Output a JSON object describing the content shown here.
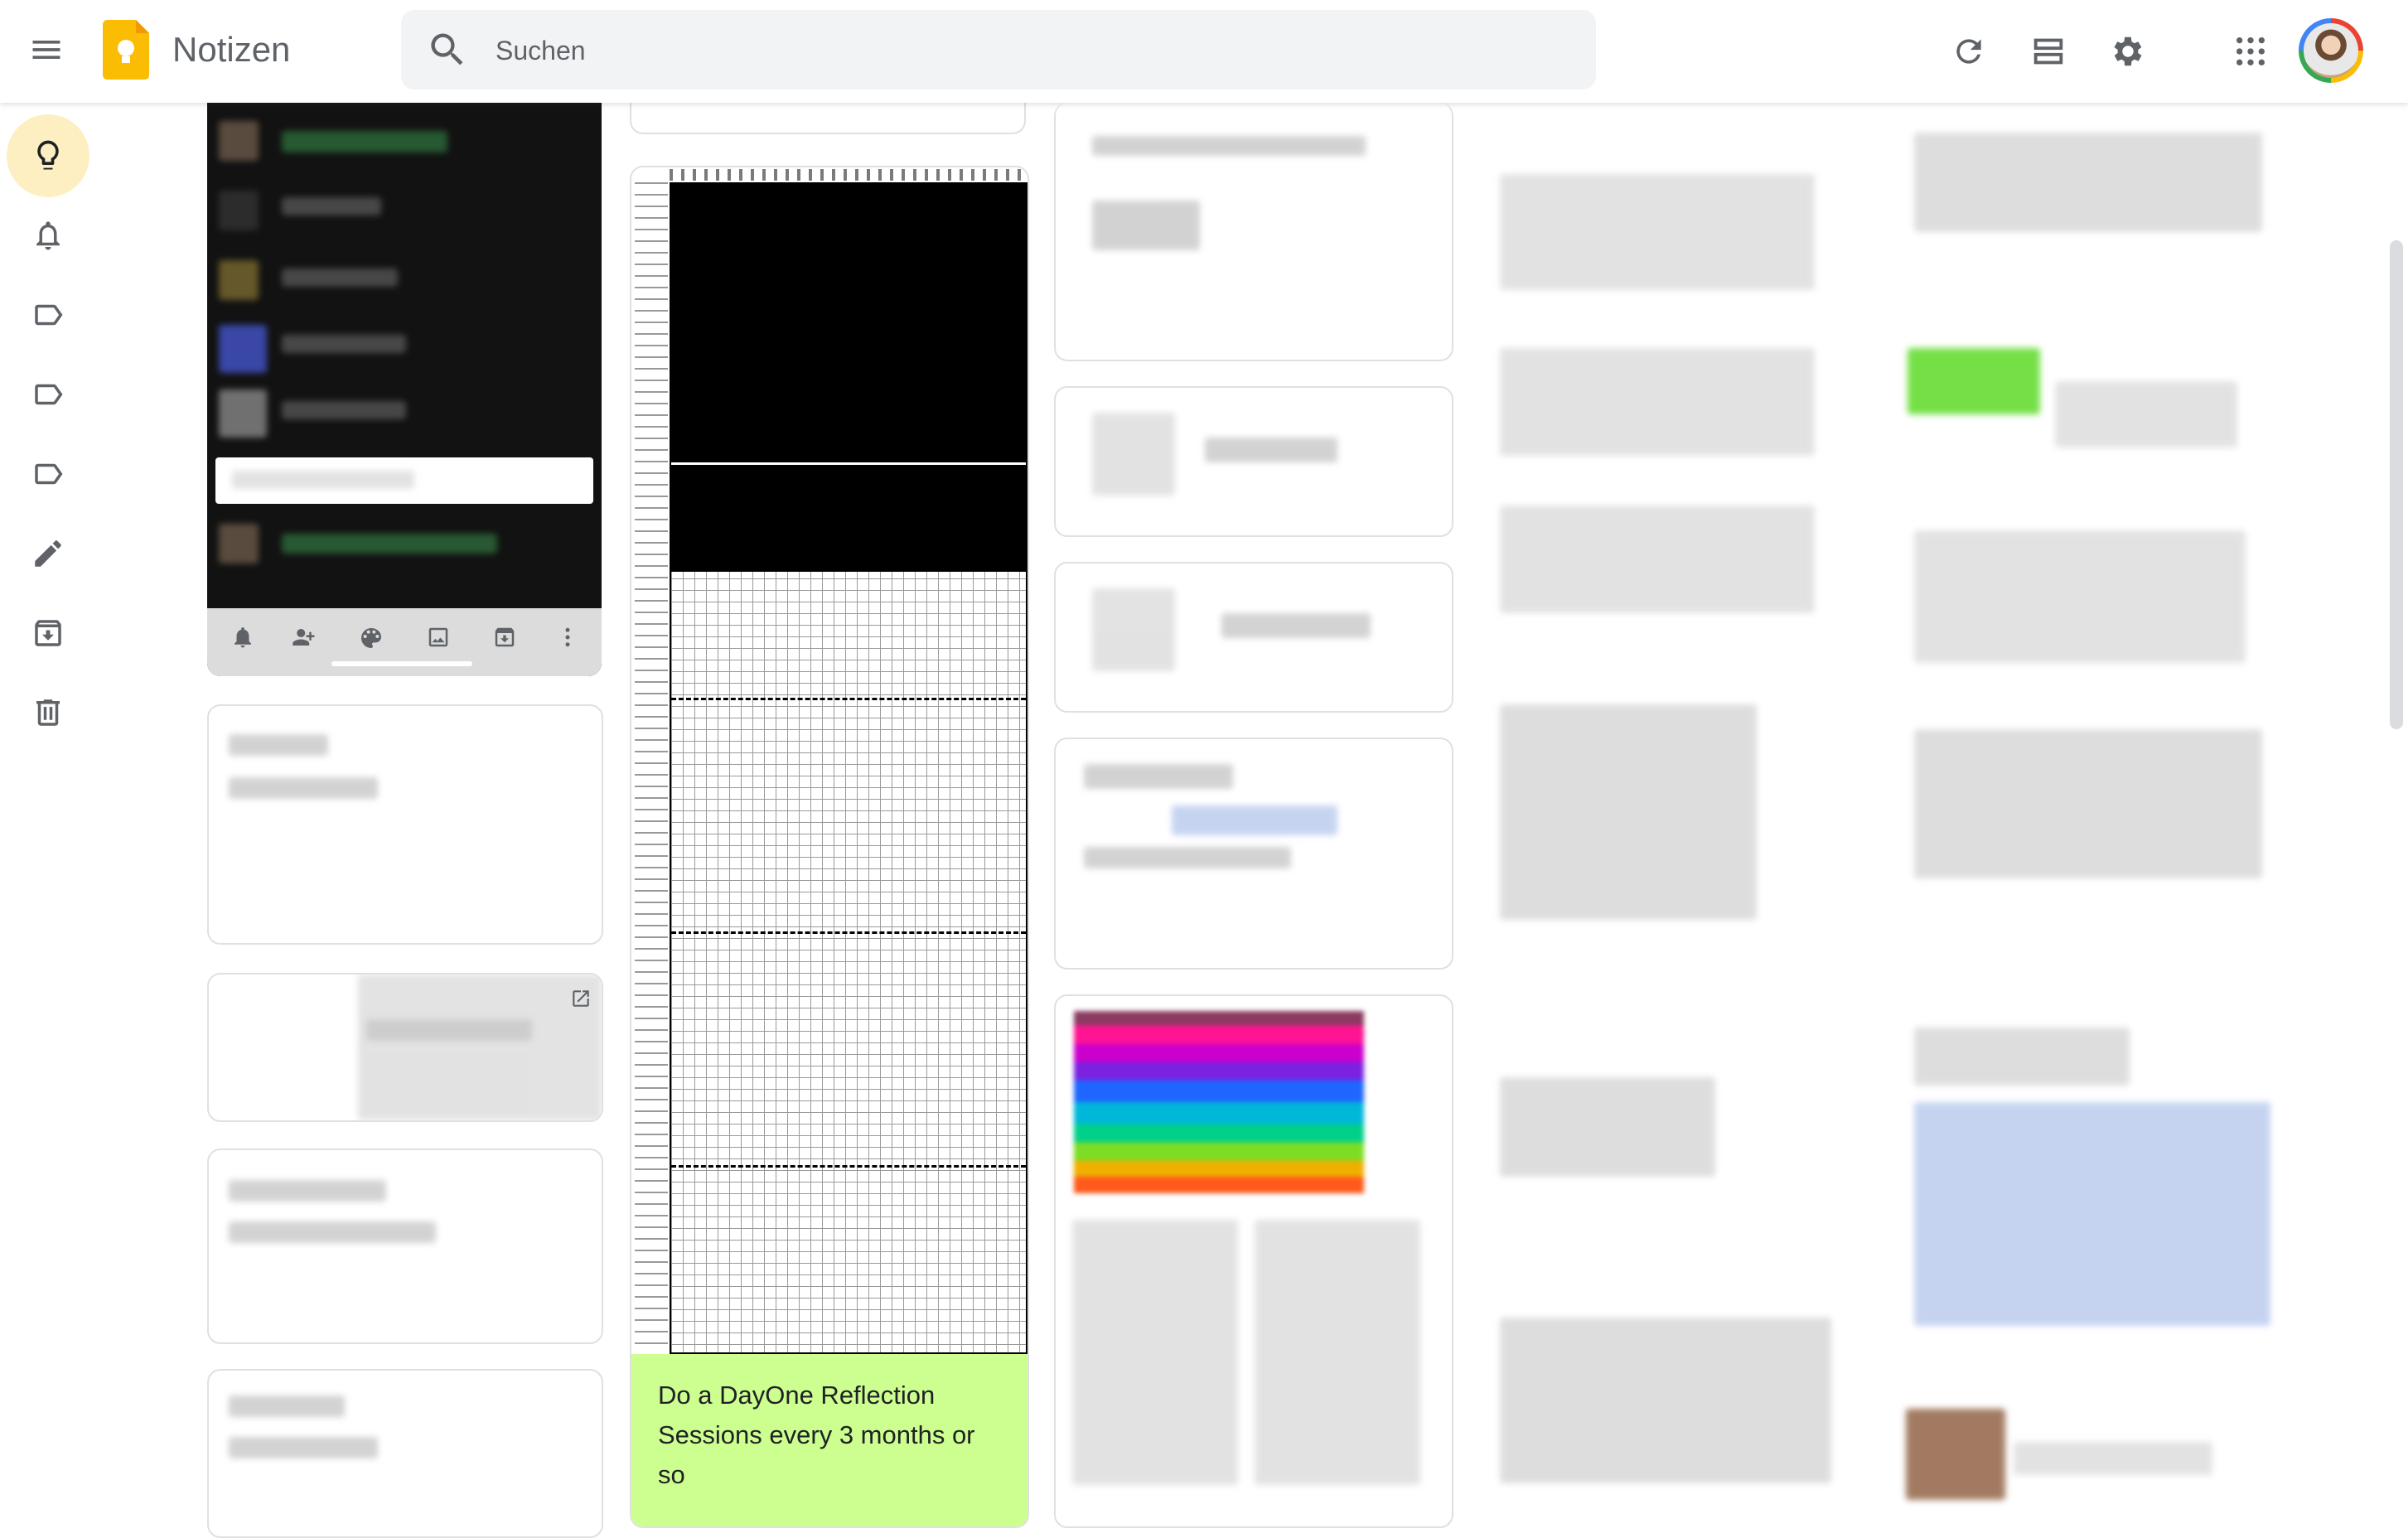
{
  "header": {
    "app_title": "Notizen",
    "search_placeholder": "Suchen",
    "icons": [
      "menu-icon",
      "keep-logo",
      "search-icon",
      "refresh-icon",
      "list-view-icon",
      "gear-icon",
      "apps-grid-icon",
      "avatar"
    ]
  },
  "sidebar": {
    "items": [
      {
        "name": "notes",
        "icon": "lightbulb-icon",
        "active": true
      },
      {
        "name": "reminders",
        "icon": "bell-icon"
      },
      {
        "name": "label-1",
        "icon": "label-icon"
      },
      {
        "name": "label-2",
        "icon": "label-icon"
      },
      {
        "name": "label-3",
        "icon": "label-icon"
      },
      {
        "name": "edit-labels",
        "icon": "pencil-icon"
      },
      {
        "name": "archive",
        "icon": "archive-icon"
      },
      {
        "name": "trash",
        "icon": "trash-icon"
      }
    ]
  },
  "notes": {
    "grid_note_caption": "Do a DayOne Reflection Sessions every 3 months or so",
    "grid_note_color": "#ccff90"
  },
  "colors": {
    "active_sidebar": "#feefc3",
    "search_bg": "#f1f3f4",
    "keep_yellow": "#fbbc04"
  }
}
